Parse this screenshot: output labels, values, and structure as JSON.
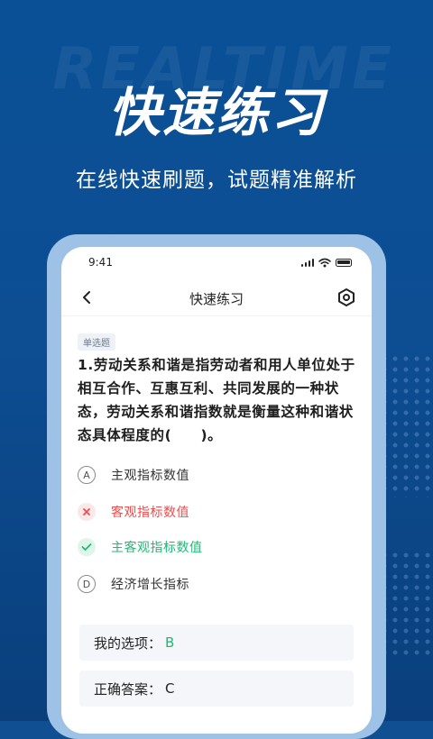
{
  "banner": {
    "watermark": "REALTIME",
    "title": "快速练习",
    "subtitle": "在线快速刷题，试题精准解析"
  },
  "status_bar": {
    "time": "9:41"
  },
  "nav": {
    "title": "快速练习"
  },
  "question": {
    "type_tag": "单选题",
    "text": "1.劳动关系和谐是指劳动者和用人单位处于相互合作、互惠互利、共同发展的一种状态，劳动关系和谐指数就是衡量这种和谐状态具体程度的(　　)。",
    "options": [
      {
        "mark": "A",
        "label": "主观指标数值",
        "state": "normal"
      },
      {
        "mark": "",
        "label": "客观指标数值",
        "state": "wrong"
      },
      {
        "mark": "",
        "label": "主客观指标数值",
        "state": "correct"
      },
      {
        "mark": "D",
        "label": "经济增长指标",
        "state": "normal"
      }
    ]
  },
  "result": {
    "my_choice_label": "我的选项：",
    "my_choice_value": "B",
    "correct_label": "正确答案：",
    "correct_value": "C"
  },
  "colors": {
    "background": "#0f4f92",
    "wrong": "#ef4c4c",
    "correct": "#20b877"
  }
}
